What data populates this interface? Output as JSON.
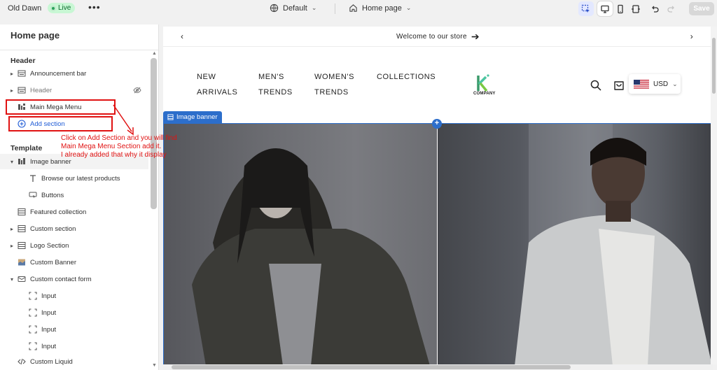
{
  "topbar": {
    "app_title": "Old Dawn",
    "live_label": "Live",
    "theme_label": "Default",
    "page_label": "Home page",
    "save_label": "Save"
  },
  "sidebar": {
    "title": "Home page",
    "header_group": "Header",
    "header_items": [
      {
        "label": "Announcement bar"
      },
      {
        "label": "Header"
      },
      {
        "label": "Main Mega Menu"
      }
    ],
    "add_section_label": "Add section",
    "template_group": "Template",
    "template_items": [
      {
        "label": "Image banner"
      },
      {
        "label": "Browse our latest products"
      },
      {
        "label": "Buttons"
      },
      {
        "label": "Featured collection"
      },
      {
        "label": "Custom section"
      },
      {
        "label": "Logo Section"
      },
      {
        "label": "Custom Banner"
      },
      {
        "label": "Custom contact form"
      },
      {
        "label": "Input"
      },
      {
        "label": "Input"
      },
      {
        "label": "Input"
      },
      {
        "label": "Input"
      },
      {
        "label": "Custom Liquid"
      }
    ]
  },
  "annotation": {
    "line1": "Click on Add Section and you will find",
    "line2": "Main Mega Menu Section add it.",
    "line3": "I already added that why it display",
    "color": "#e01212"
  },
  "store": {
    "announcement": "Welcome to our store",
    "nav": [
      {
        "label": "NEW ARRIVALS"
      },
      {
        "label": "MEN'S TRENDS"
      },
      {
        "label": "WOMEN'S TRENDS"
      },
      {
        "label": "COLLECTIONS"
      }
    ],
    "logo_text": "COMPANY",
    "currency": "USD",
    "banner_tag": "Image banner"
  },
  "colors": {
    "accent": "#2c6ecb",
    "live_green": "#29a35a"
  }
}
